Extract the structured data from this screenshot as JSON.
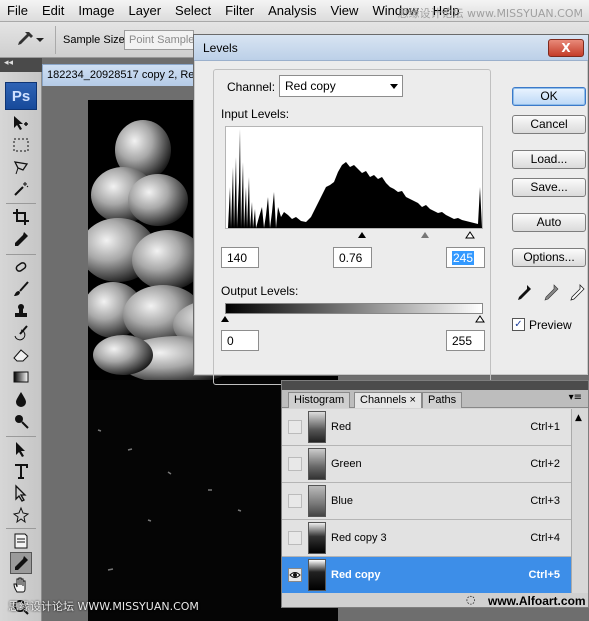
{
  "menu": [
    "File",
    "Edit",
    "Image",
    "Layer",
    "Select",
    "Filter",
    "Analysis",
    "View",
    "Window",
    "Help"
  ],
  "watermark_top": "思缘设计论坛 www.MISSYUAN.COM",
  "options_bar": {
    "tool_icon": "eyedropper-icon",
    "sample_size_label": "Sample Size:",
    "sample_size_value": "Point Sample"
  },
  "tools": {
    "app_badge": "Ps"
  },
  "document": {
    "tab_title": "182234_20928517 copy 2, Re"
  },
  "levels": {
    "title": "Levels",
    "close": "X",
    "channel_label": "Channel:",
    "channel_value": "Red copy",
    "input_label": "Input Levels:",
    "input_black": "140",
    "input_gamma": "0.76",
    "input_white": "245",
    "output_label": "Output Levels:",
    "output_black": "0",
    "output_white": "255",
    "buttons": {
      "ok": "OK",
      "cancel": "Cancel",
      "load": "Load...",
      "save": "Save...",
      "auto": "Auto",
      "options": "Options..."
    },
    "preview_label": "Preview",
    "preview_checked": true
  },
  "channels_panel": {
    "tabs": [
      "Histogram",
      "Channels ×",
      "Paths"
    ],
    "active_tab": "Channels ×",
    "channels": [
      {
        "name": "Red",
        "shortcut": "Ctrl+1",
        "selected": false
      },
      {
        "name": "Green",
        "shortcut": "Ctrl+2",
        "selected": false
      },
      {
        "name": "Blue",
        "shortcut": "Ctrl+3",
        "selected": false
      },
      {
        "name": "Red copy 3",
        "shortcut": "Ctrl+4",
        "selected": false
      },
      {
        "name": "Red copy",
        "shortcut": "Ctrl+5",
        "selected": true
      }
    ]
  },
  "watermark_bottom_left": "思缘设计论坛 WWW.MISSYUAN.COM",
  "watermark_bottom_right": "www.Alfoart.com"
}
